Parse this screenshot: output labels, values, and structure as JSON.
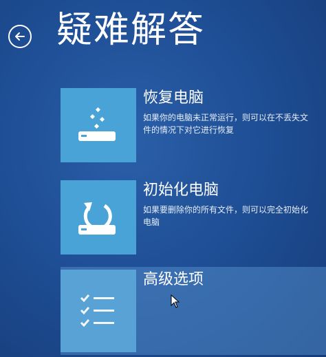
{
  "header": {
    "title": "疑难解答",
    "back_icon": "back-arrow-icon"
  },
  "options": [
    {
      "title": "恢复电脑",
      "description": "如果你的电脑未正常运行，则可以在不丢失文件的情况下对它进行恢复",
      "icon": "refresh-pc-icon"
    },
    {
      "title": "初始化电脑",
      "description": "如果要删除你的所有文件，则可以完全初始化电脑",
      "icon": "reset-pc-icon"
    },
    {
      "title": "高级选项",
      "description": "",
      "icon": "checklist-icon"
    }
  ],
  "colors": {
    "background": "#1f4f96",
    "tile": "#4aa3d6",
    "selected_tile": "#5aa5d8"
  }
}
